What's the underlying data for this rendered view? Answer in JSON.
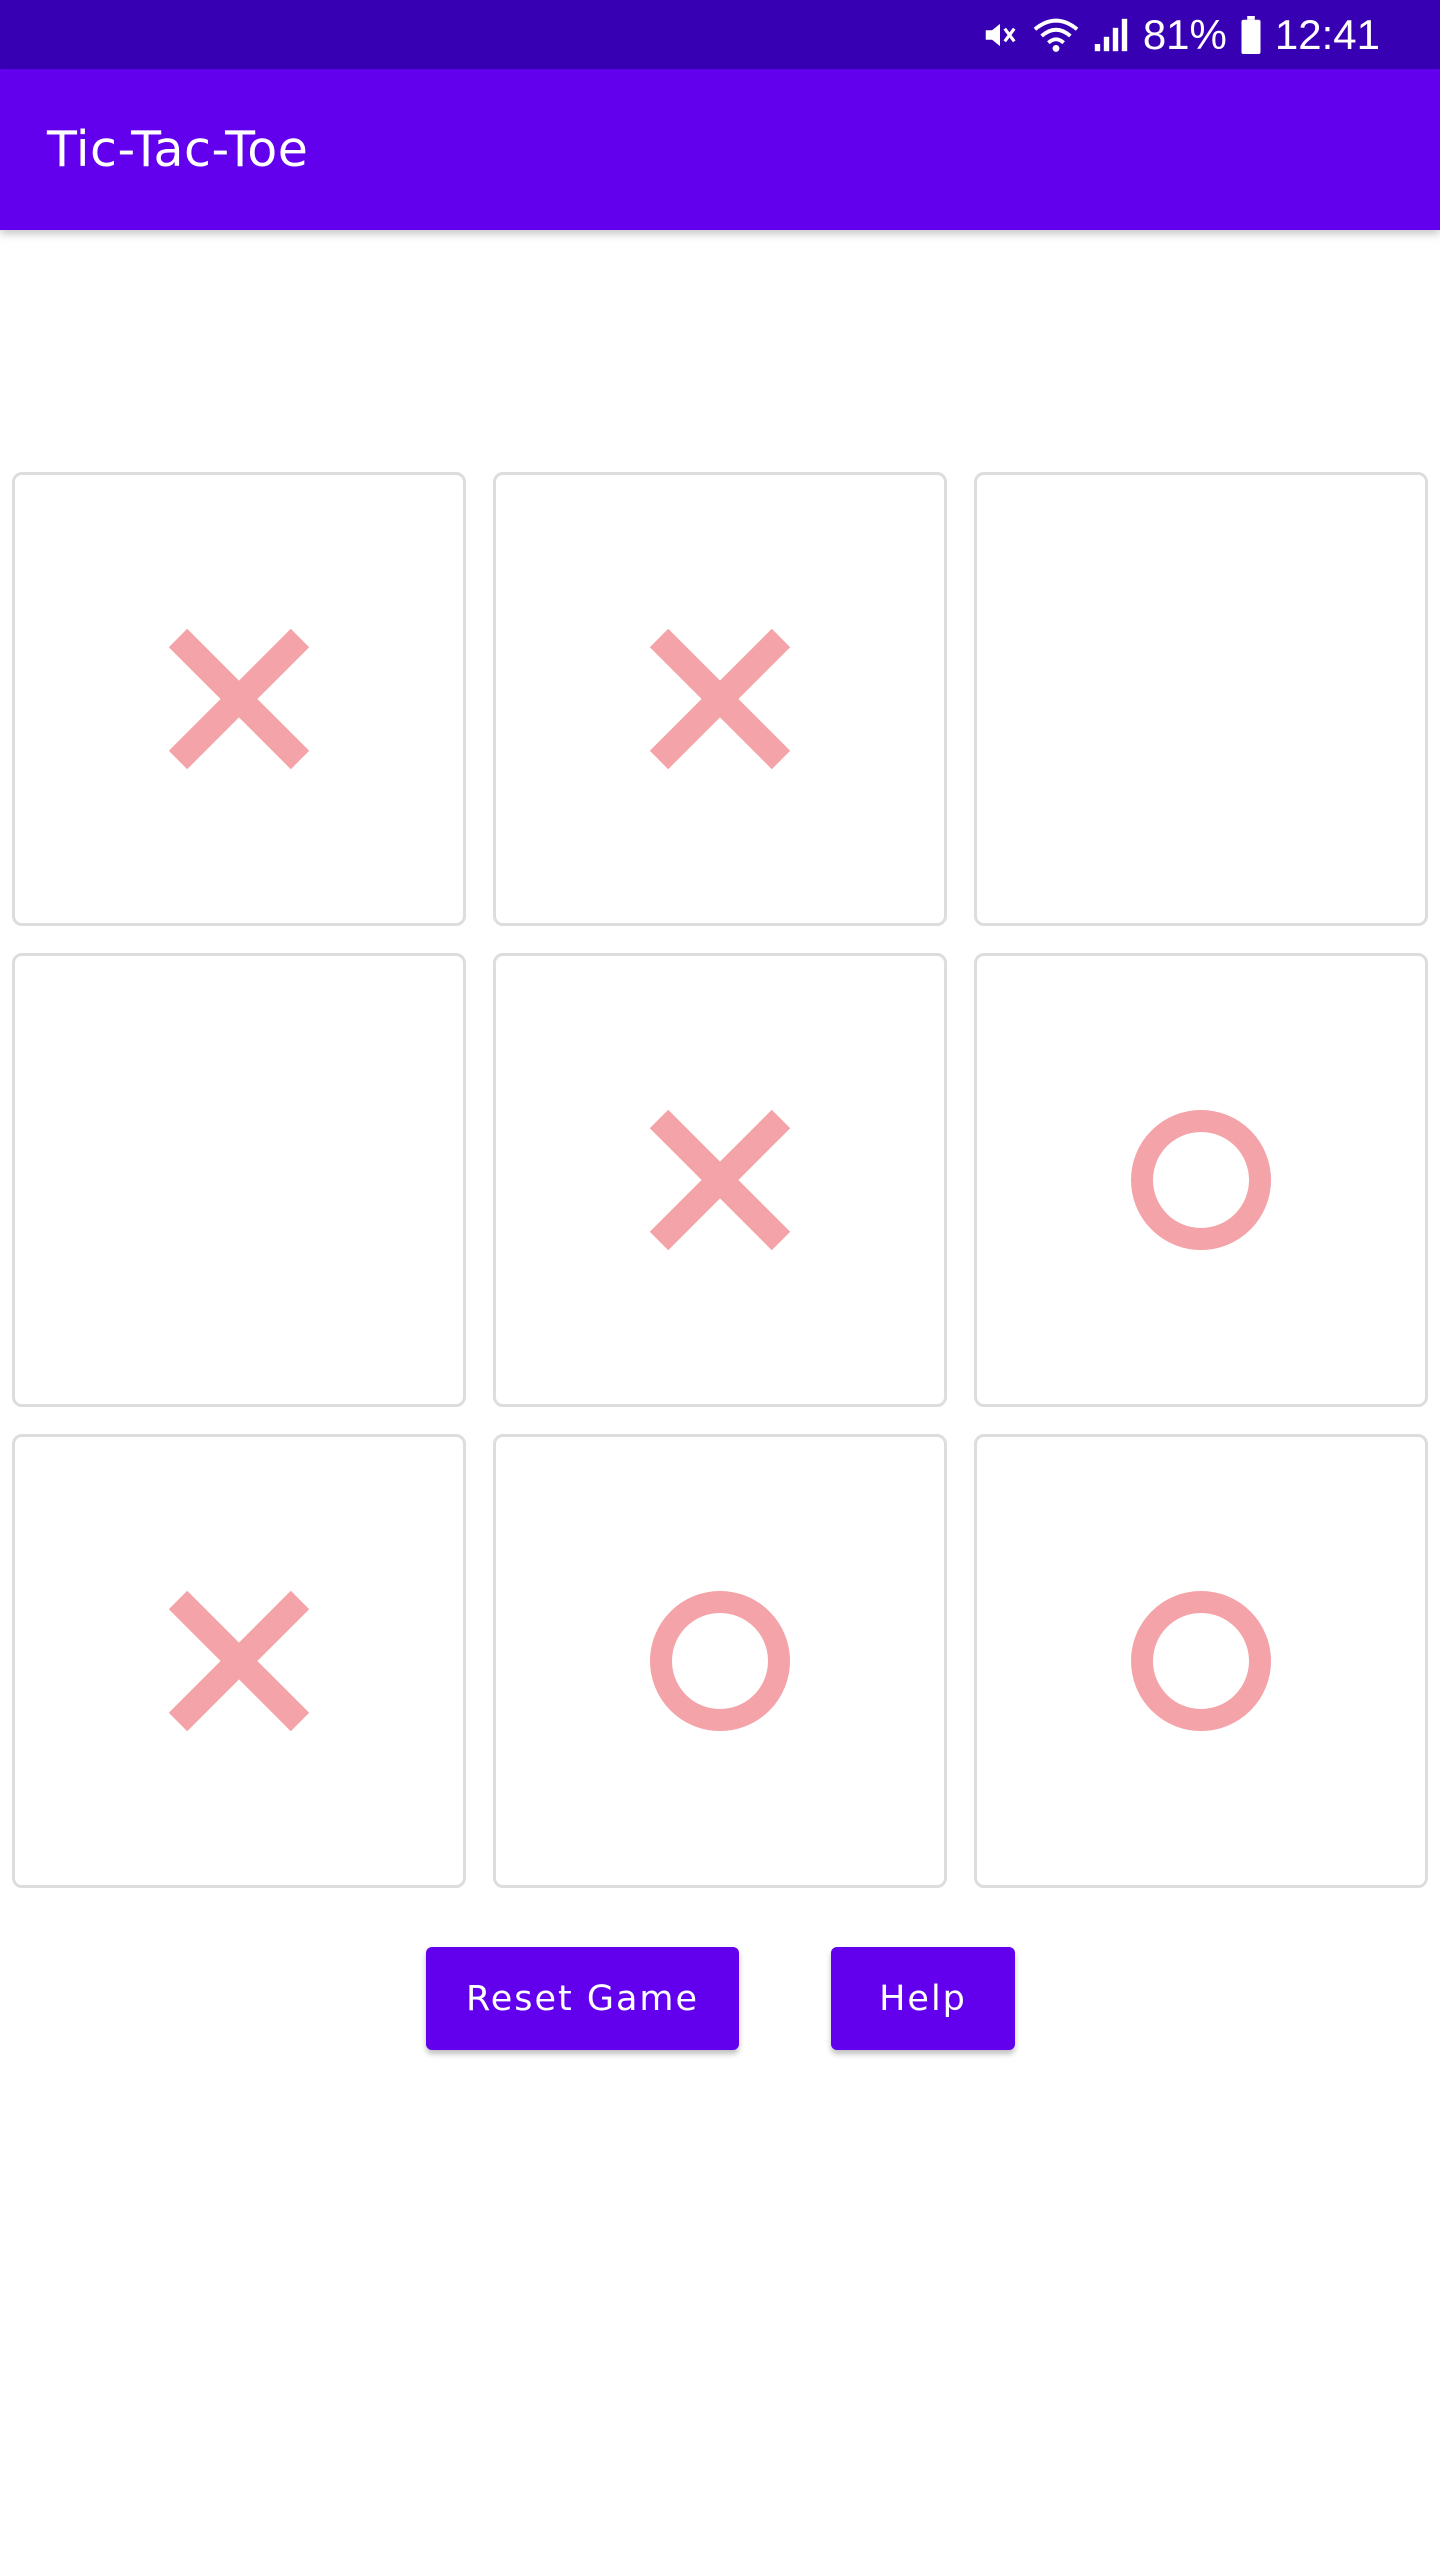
{
  "status_bar": {
    "battery": "81%",
    "time": "12:41",
    "icons": [
      "mute-icon",
      "wifi-icon",
      "signal-icon",
      "battery-icon"
    ]
  },
  "app_bar": {
    "title": "Tic-Tac-Toe"
  },
  "board": {
    "cells": [
      "X",
      "X",
      "",
      "",
      "X",
      "O",
      "X",
      "O",
      "O"
    ]
  },
  "buttons": {
    "reset": "Reset Game",
    "help": "Help"
  },
  "colors": {
    "status_bar": "#3700b3",
    "app_bar": "#6200ee",
    "mark": "#f4a3a8",
    "cell_border": "#dddddd"
  }
}
